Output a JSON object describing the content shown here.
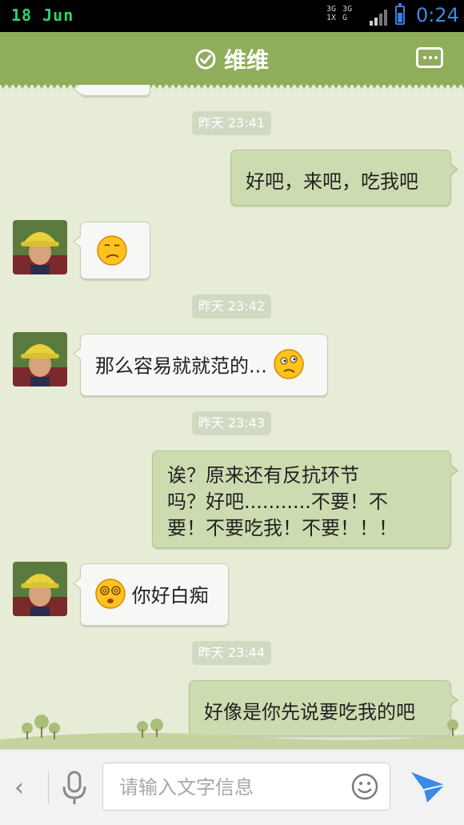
{
  "status_bar": {
    "date": "18 Jun",
    "network": "3G 3G 1X G",
    "time": "0:24"
  },
  "header": {
    "title": "维维"
  },
  "messages": [
    {
      "type": "timestamp",
      "text": "昨天 23:41"
    },
    {
      "type": "outgoing",
      "text": "好吧，来吧，吃我吧"
    },
    {
      "type": "incoming",
      "text": "",
      "emoji": "confused-face"
    },
    {
      "type": "timestamp",
      "text": "昨天 23:42"
    },
    {
      "type": "incoming",
      "text": "那么容易就就范的...",
      "emoji": "puzzled-face"
    },
    {
      "type": "timestamp",
      "text": "昨天 23:43"
    },
    {
      "type": "outgoing",
      "lines": [
        "诶？原来还有反抗环节",
        "吗？好吧...........不要！不",
        "要！不要吃我！不要！！！"
      ]
    },
    {
      "type": "incoming",
      "text": "你好白痴",
      "emoji": "dizzy-face"
    },
    {
      "type": "timestamp",
      "text": "昨天 23:44"
    },
    {
      "type": "outgoing",
      "text": "好像是你先说要吃我的吧"
    }
  ],
  "input_bar": {
    "placeholder": "请输入文字信息"
  },
  "colors": {
    "header": "#8fad5b",
    "chat_background": "#e6ecd6",
    "outgoing_bubble": "#cddcb0",
    "incoming_bubble": "#f7f7f5",
    "send_icon": "#3b8ae8"
  }
}
